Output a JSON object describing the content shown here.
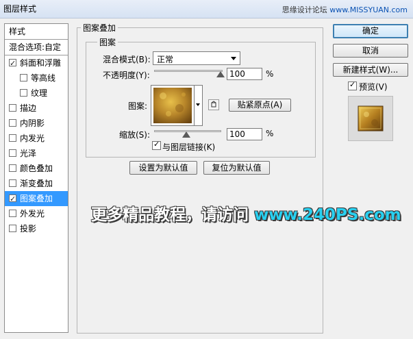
{
  "window": {
    "title": "图层样式",
    "watermark_prefix": "思缘设计论坛 ",
    "watermark_site": "www.MISSYUAN.com"
  },
  "left_panel": {
    "header": "样式",
    "blend_options": "混合选项:自定",
    "items": [
      {
        "label": "斜面和浮雕",
        "checked": true,
        "indent": false
      },
      {
        "label": "等高线",
        "checked": false,
        "indent": true
      },
      {
        "label": "纹理",
        "checked": false,
        "indent": true
      },
      {
        "label": "描边",
        "checked": false,
        "indent": false
      },
      {
        "label": "内阴影",
        "checked": false,
        "indent": false
      },
      {
        "label": "内发光",
        "checked": false,
        "indent": false
      },
      {
        "label": "光泽",
        "checked": false,
        "indent": false
      },
      {
        "label": "颜色叠加",
        "checked": false,
        "indent": false
      },
      {
        "label": "渐变叠加",
        "checked": false,
        "indent": false
      },
      {
        "label": "图案叠加",
        "checked": true,
        "indent": false,
        "selected": true
      },
      {
        "label": "外发光",
        "checked": false,
        "indent": false
      },
      {
        "label": "投影",
        "checked": false,
        "indent": false
      }
    ]
  },
  "main": {
    "group_title": "图案叠加",
    "subgroup_title": "图案",
    "blend_mode_label": "混合模式(B):",
    "blend_mode_value": "正常",
    "opacity_label": "不透明度(Y):",
    "opacity_value": "100",
    "percent": "%",
    "pattern_label": "图案:",
    "snap_origin_button": "贴紧原点(A)",
    "scale_label": "缩放(S):",
    "scale_value": "100",
    "link_layer_label": "与图层链接(K)",
    "link_layer_checked": true,
    "set_default_button": "设置为默认值",
    "reset_default_button": "复位为默认值"
  },
  "right_panel": {
    "ok_button": "确定",
    "cancel_button": "取消",
    "new_style_button": "新建样式(W)...",
    "preview_label": "预览(V)",
    "preview_checked": true
  },
  "promo": {
    "text": "更多精品教程，请访问 ",
    "url": "www.240PS.com"
  },
  "colors": {
    "selection": "#3399ff",
    "promo_url": "#28d0f0",
    "default_button_border": "#3c7fb1"
  }
}
